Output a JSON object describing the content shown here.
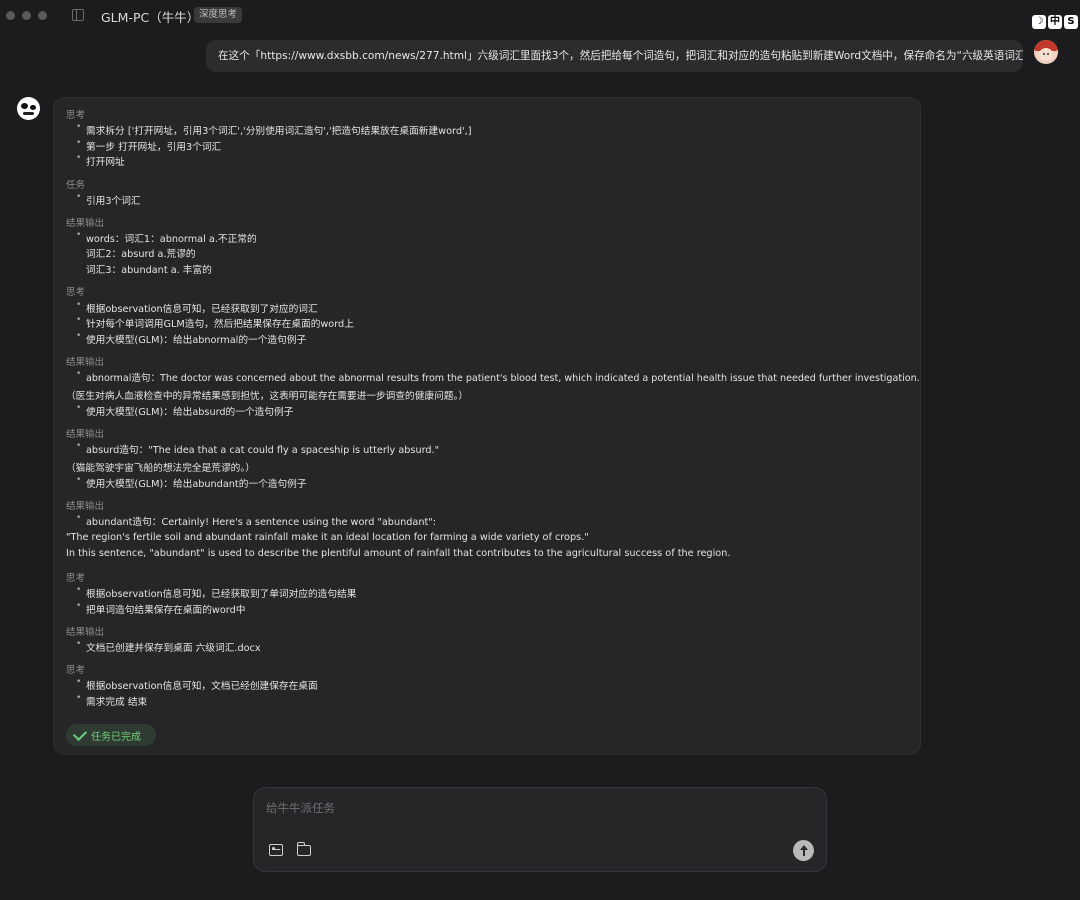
{
  "window": {
    "title": "GLM-PC（牛牛）",
    "mode_badge": "深度思考",
    "sys_icons": [
      "☽",
      "中",
      "S"
    ]
  },
  "user_message": "在这个「https://www.dxsbb.com/news/277.html」六级词汇里面找3个，然后把给每个词造句，把词汇和对应的造句粘贴到新建Word文档中，保存命名为“六级英语词汇学习”",
  "response": {
    "s1_label": "思考",
    "s1_l1": "需求拆分 ['打开网址，引用3个词汇','分别使用词汇造句','把造句结果放在桌面新建word',]",
    "s1_l2": "第一步 打开网址，引用3个词汇",
    "s1_l3": "打开网址",
    "s2_label": "任务",
    "s2_l1": "引用3个词汇",
    "s3_label": "结果输出",
    "s3_l1": "words：词汇1：abnormal a.不正常的",
    "s3_l2": "词汇2：absurd a.荒谬的",
    "s3_l3": "词汇3：abundant a. 丰富的",
    "s4_label": "思考",
    "s4_l1": "根据observation信息可知，已经获取到了对应的词汇",
    "s4_l2": "针对每个单词调用GLM造句，然后把结果保存在桌面的word上",
    "s4_l3": "使用大模型(GLM)：给出abnormal的一个造句例子",
    "s5_label": "结果输出",
    "s5_l1": "abnormal造句：The doctor was concerned about the abnormal results from the patient's blood test, which indicated a potential health issue that needed further investigation.",
    "s5_l2": "（医生对病人血液检查中的异常结果感到担忧，这表明可能存在需要进一步调查的健康问题。）",
    "s5_l3": "使用大模型(GLM)：给出absurd的一个造句例子",
    "s6_label": "结果输出",
    "s6_l1": "absurd造句：\"The idea that a cat could fly a spaceship is utterly absurd.\"",
    "s6_l2": "（猫能驾驶宇宙飞船的想法完全是荒谬的。）",
    "s6_l3": "使用大模型(GLM)：给出abundant的一个造句例子",
    "s7_label": "结果输出",
    "s7_l1": "abundant造句：Certainly! Here's a sentence using the word \"abundant\":",
    "s7_l2": "\"The region's fertile soil and abundant rainfall make it an ideal location for farming a wide variety of crops.\"",
    "s7_l3": "In this sentence, \"abundant\" is used to describe the plentiful amount of rainfall that contributes to the agricultural success of the region.",
    "s8_label": "思考",
    "s8_l1": "根据observation信息可知，已经获取到了单词对应的造句结果",
    "s8_l2": "把单词造句结果保存在桌面的word中",
    "s9_label": "结果输出",
    "s9_l1": "文档已创建并保存到桌面 六级词汇.docx",
    "s10_label": "思考",
    "s10_l1": "根据observation信息可知，文档已经创建保存在桌面",
    "s10_l2": "需求完成 结束",
    "status": "任务已完成"
  },
  "composer": {
    "placeholder": "给牛牛派任务"
  },
  "colors": {
    "background": "#1c1c1e",
    "card": "#262628",
    "success": "#6fce7b"
  }
}
